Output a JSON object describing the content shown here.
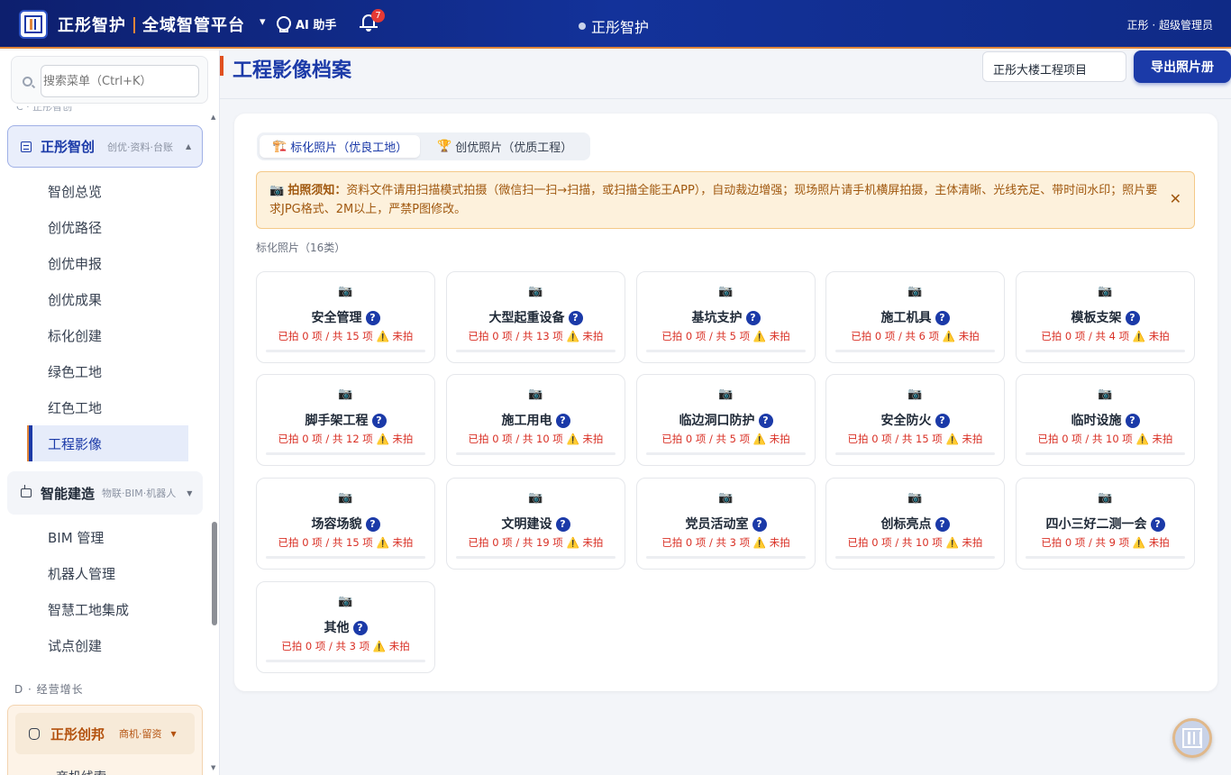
{
  "header": {
    "brand_left": "正彤智护",
    "brand_right": "全域智管平台",
    "caret": "▾",
    "ai_label": "AI 助手",
    "notification_count": "7",
    "center_title": "正彤智护",
    "user": "正彤 · 超级管理员"
  },
  "sidebar": {
    "search_placeholder": "搜索菜单（Ctrl+K）",
    "cut_label": "C · 正彤智创",
    "group_active": {
      "title": "正彤智创",
      "sub": "创优·资料·台账",
      "caret": "▲"
    },
    "items": [
      "智创总览",
      "创优路径",
      "创优申报",
      "创优成果",
      "标化创建",
      "绿色工地",
      "红色工地",
      "工程影像"
    ],
    "group2": {
      "title": "智能建造",
      "sub": "物联·BIM·机器人",
      "caret": "▼"
    },
    "items2": [
      "BIM 管理",
      "机器人管理",
      "智慧工地集成",
      "试点创建"
    ],
    "section_label": "D · 经营增长",
    "group3": {
      "title": "正彤创邦",
      "sub": "商机·留资",
      "caret": "▼"
    },
    "cut_item": "商机线索",
    "scroll_up": "▲",
    "scroll_down": "▼"
  },
  "main": {
    "title": "工程影像档案",
    "project": "正彤大楼工程项目",
    "export_label": "导出照片册",
    "tabs": [
      {
        "icon": "🏗️",
        "label": "标化照片（优良工地）"
      },
      {
        "icon": "🏆",
        "label": "创优照片（优质工程）"
      }
    ],
    "notice_icon": "📷",
    "notice_title": "拍照须知：",
    "notice_text": "资料文件请用扫描模式拍摄（微信扫一扫→扫描，或扫描全能王APP），自动裁边增强；现场照片请手机横屏拍摄，主体清晰、光线充足、带时间水印；照片要求JPG格式、2M以上，严禁P图修改。",
    "notice_close": "✕",
    "category_count": "标化照片（16类）",
    "camera_icon": "📷",
    "help_mark": "?",
    "categories": [
      {
        "name": "安全管理",
        "status": "已拍 0 项 / 共 15 项 ⚠️ 未拍",
        "progress": 0
      },
      {
        "name": "大型起重设备",
        "status": "已拍 0 项 / 共 13 项 ⚠️ 未拍",
        "progress": 0
      },
      {
        "name": "基坑支护",
        "status": "已拍 0 项 / 共 5 项 ⚠️ 未拍",
        "progress": 0
      },
      {
        "name": "施工机具",
        "status": "已拍 0 项 / 共 6 项 ⚠️ 未拍",
        "progress": 0
      },
      {
        "name": "模板支架",
        "status": "已拍 0 项 / 共 4 项 ⚠️ 未拍",
        "progress": 0
      },
      {
        "name": "脚手架工程",
        "status": "已拍 0 项 / 共 12 项 ⚠️ 未拍",
        "progress": 0
      },
      {
        "name": "施工用电",
        "status": "已拍 0 项 / 共 10 项 ⚠️ 未拍",
        "progress": 0
      },
      {
        "name": "临边洞口防护",
        "status": "已拍 0 项 / 共 5 项 ⚠️ 未拍",
        "progress": 0
      },
      {
        "name": "安全防火",
        "status": "已拍 0 项 / 共 15 项 ⚠️ 未拍",
        "progress": 0
      },
      {
        "name": "临时设施",
        "status": "已拍 0 项 / 共 10 项 ⚠️ 未拍",
        "progress": 0
      },
      {
        "name": "场容场貌",
        "status": "已拍 0 项 / 共 15 项 ⚠️ 未拍",
        "progress": 0
      },
      {
        "name": "文明建设",
        "status": "已拍 0 项 / 共 19 项 ⚠️ 未拍",
        "progress": 0
      },
      {
        "name": "党员活动室",
        "status": "已拍 0 项 / 共 3 项 ⚠️ 未拍",
        "progress": 0
      },
      {
        "name": "创标亮点",
        "status": "已拍 0 项 / 共 10 项 ⚠️ 未拍",
        "progress": 0
      },
      {
        "name": "四小三好二测一会",
        "status": "已拍 0 项 / 共 9 项 ⚠️ 未拍",
        "progress": 0
      },
      {
        "name": "其他",
        "status": "已拍 0 项 / 共 3 项 ⚠️ 未拍",
        "progress": 0
      }
    ]
  },
  "colors": {
    "primary": "#1b3aa8",
    "accent": "#e0863a",
    "warning_text": "#a0580f",
    "danger": "#d93025"
  }
}
